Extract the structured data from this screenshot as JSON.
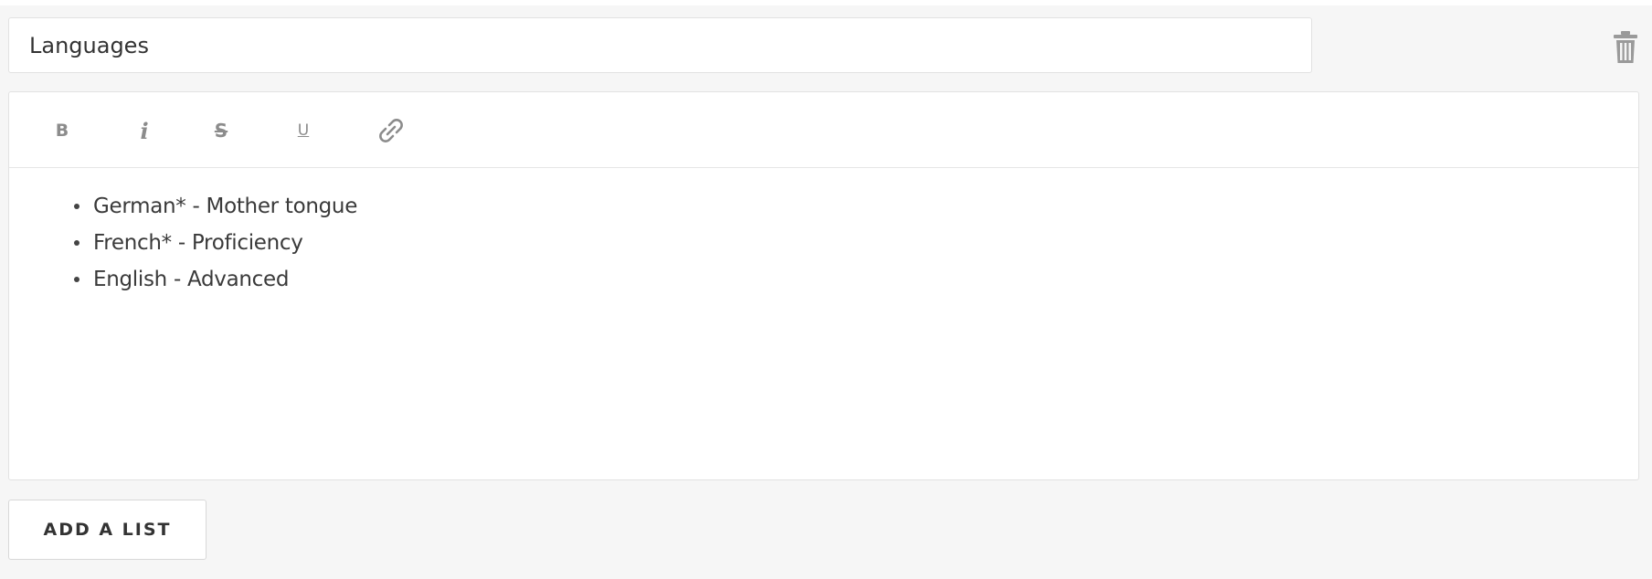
{
  "section": {
    "title_value": "Languages"
  },
  "toolbar": {
    "bold_label": "B",
    "italic_label": "i",
    "strike_label": "S",
    "underline_label": "U"
  },
  "icons": {
    "delete": "trash-icon",
    "link": "link-icon"
  },
  "editor": {
    "items": [
      "German* - Mother tongue",
      "French* - Proficiency",
      "English - Advanced"
    ]
  },
  "actions": {
    "add_list_label": "ADD A LIST"
  },
  "colors": {
    "panel_bg": "#f6f6f6",
    "icon_gray": "#8c8c8c",
    "border": "#e2e2e2"
  }
}
